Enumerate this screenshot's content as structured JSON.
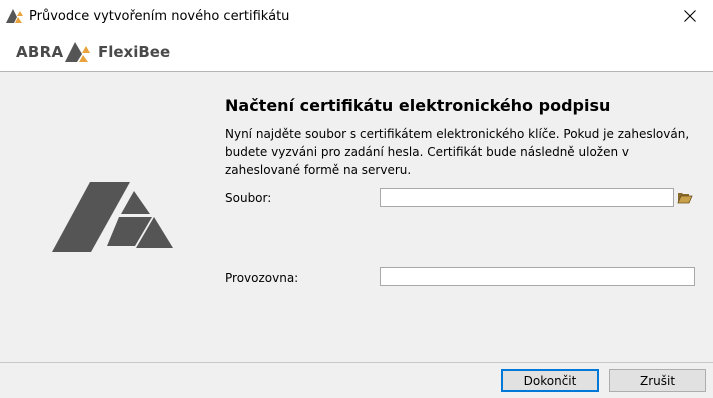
{
  "window": {
    "title": "Průvodce vytvořením nového certifikátu"
  },
  "brand": {
    "abra": "ABRA",
    "flexibee": "FlexiBee",
    "logo_color": "#555555",
    "accent": "#e8a33d"
  },
  "content": {
    "heading": "Načtení certifikátu elektronického podpisu",
    "description": "Nyní najděte soubor s certifikátem elektronického klíče. Pokud je zaheslován, budete vyzváni pro zadání hesla. Certifikát bude následně uložen v zaheslované formě na serveru.",
    "file_label": "Soubor:",
    "file_value": "",
    "branch_label": "Provozovna:",
    "branch_value": ""
  },
  "buttons": {
    "finish": "Dokončit",
    "cancel": "Zrušit"
  },
  "icons": {
    "close": "close-icon",
    "browse": "folder-open-icon"
  }
}
